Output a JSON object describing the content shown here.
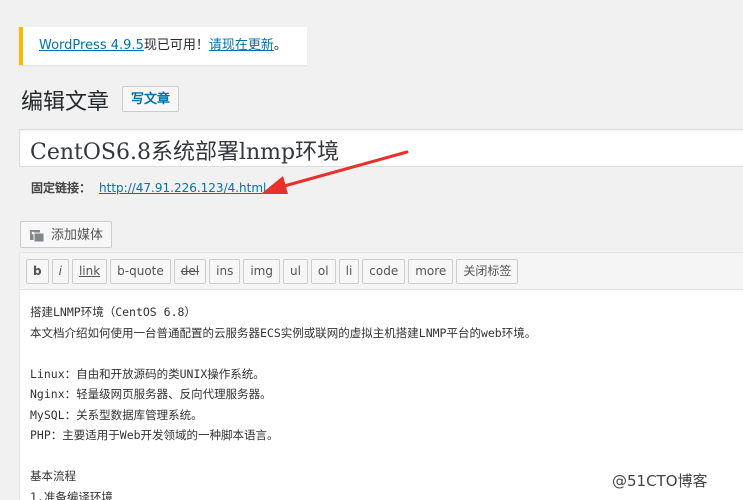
{
  "notice": {
    "version_link": "WordPress 4.9.5",
    "available_text": "现已可用！",
    "update_link": "请现在更新",
    "period": "。"
  },
  "header": {
    "title": "编辑文章",
    "add_new": "写文章"
  },
  "post": {
    "title": "CentOS6.8系统部署lnmp环境",
    "permalink_label": "固定链接：",
    "permalink_url": "http://47.91.226.123/4.html"
  },
  "media": {
    "add_media": "添加媒体"
  },
  "toolbar": {
    "buttons": [
      "b",
      "i",
      "link",
      "b-quote",
      "del",
      "ins",
      "img",
      "ul",
      "ol",
      "li",
      "code",
      "more",
      "关闭标签"
    ]
  },
  "content": {
    "lines": [
      "搭建LNMP环境（CentOS 6.8）",
      "本文档介绍如何使用一台普通配置的云服务器ECS实例或联网的虚拟主机搭建LNMP平台的web环境。",
      "",
      "Linux：自由和开放源码的类UNIX操作系统。",
      "Nginx：轻量级网页服务器、反向代理服务器。",
      "MySQL：关系型数据库管理系统。",
      "PHP：主要适用于Web开发领域的一种脚本语言。",
      "",
      "基本流程",
      "1.准备编译环境"
    ]
  },
  "watermark": "@51CTO博客",
  "colors": {
    "link": "#0073aa",
    "notice_border": "#ffb900",
    "arrow": "#e8312a"
  }
}
